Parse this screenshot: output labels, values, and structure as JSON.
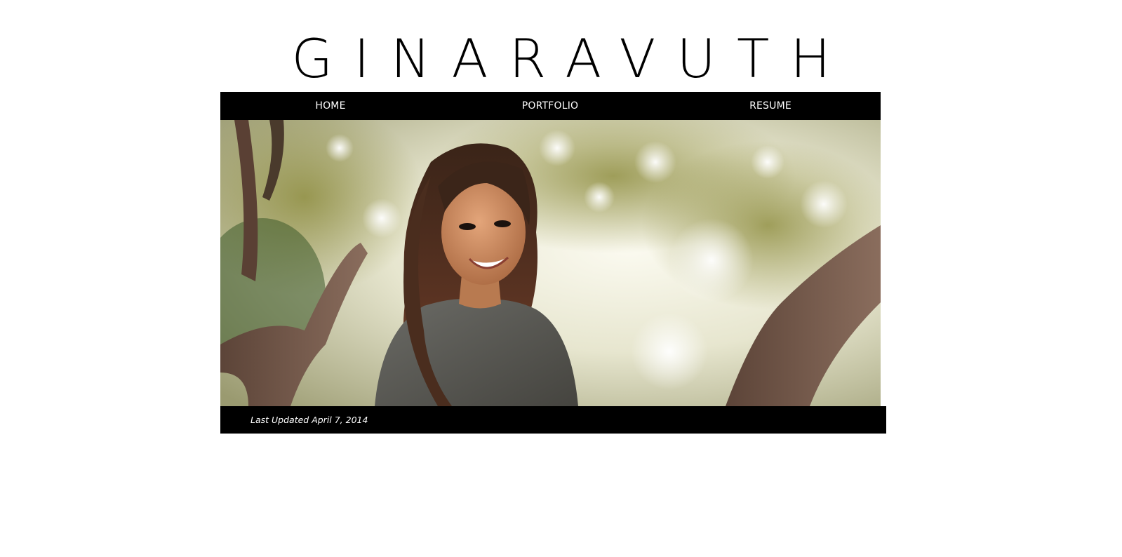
{
  "site": {
    "title": "GINARAVUTH"
  },
  "nav": {
    "items": [
      {
        "label": "HOME"
      },
      {
        "label": "PORTFOLIO"
      },
      {
        "label": "RESUME"
      }
    ]
  },
  "hero": {
    "image": "portrait-photo"
  },
  "footer": {
    "updated": "Last Updated April 7, 2014"
  }
}
